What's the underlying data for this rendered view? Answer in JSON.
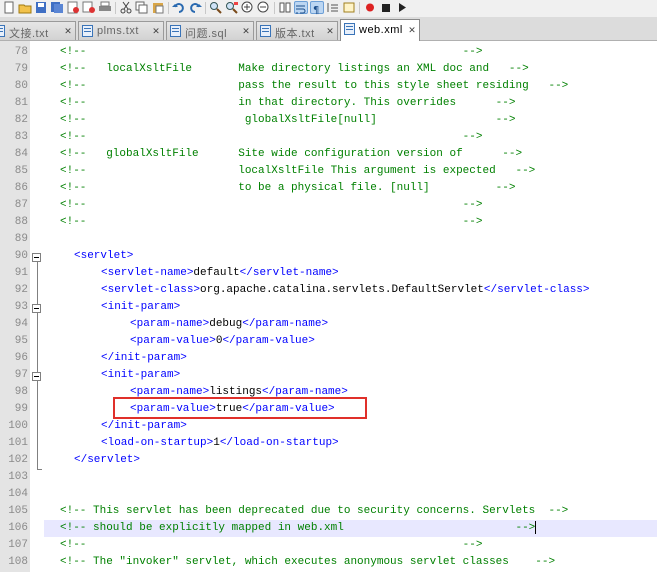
{
  "toolbar": {
    "buttons": [
      "new-file-icon",
      "open-file-icon",
      "save-icon",
      "save-all-icon",
      "close-icon",
      "close-all-icon",
      "print-icon",
      "cut-icon",
      "copy-icon",
      "paste-icon",
      "undo-icon",
      "redo-icon",
      "find-icon",
      "replace-icon",
      "zoom-in-icon",
      "zoom-out-icon",
      "sync-scroll-icon",
      "word-wrap-icon",
      "show-all-chars-icon",
      "indent-guide-icon",
      "user-lang-icon",
      "record-macro-icon",
      "stop-record-icon",
      "play-macro-icon"
    ],
    "active": [
      "word-wrap-icon",
      "show-all-chars-icon"
    ]
  },
  "tabs": [
    {
      "label": "文接.txt",
      "active": false
    },
    {
      "label": "plms.txt",
      "active": false
    },
    {
      "label": "问题.sql",
      "active": false
    },
    {
      "label": "版本.txt",
      "active": false
    },
    {
      "label": "web.xml",
      "active": true
    }
  ],
  "lines": [
    {
      "n": "78",
      "text": "<!--                                                         -->"
    },
    {
      "n": "79",
      "text": "<!--   localXsltFile       Make directory listings an XML doc and   -->"
    },
    {
      "n": "80",
      "text": "<!--                       pass the result to this style sheet residing   -->"
    },
    {
      "n": "81",
      "text": "<!--                       in that directory. This overrides      -->"
    },
    {
      "n": "82",
      "text": "<!--                        globalXsltFile[null]                  -->"
    },
    {
      "n": "83",
      "text": "<!--                                                         -->"
    },
    {
      "n": "84",
      "text": "<!--   globalXsltFile      Site wide configuration version of      -->"
    },
    {
      "n": "85",
      "text": "<!--                       localXsltFile This argument is expected   -->"
    },
    {
      "n": "86",
      "text": "<!--                       to be a physical file. [null]          -->"
    },
    {
      "n": "87",
      "text": "<!--                                                         -->"
    },
    {
      "n": "88",
      "text": "<!--                                                         -->"
    },
    {
      "n": "89",
      "text": ""
    },
    {
      "n": "90",
      "text": "<servlet>"
    },
    {
      "n": "91",
      "text": "<servlet-name>default</servlet-name>"
    },
    {
      "n": "92",
      "text": "<servlet-class>org.apache.catalina.servlets.DefaultServlet</servlet-class>"
    },
    {
      "n": "93",
      "text": "<init-param>"
    },
    {
      "n": "94",
      "text": "<param-name>debug</param-name>"
    },
    {
      "n": "95",
      "text": "<param-value>0</param-value>"
    },
    {
      "n": "96",
      "text": "</init-param>"
    },
    {
      "n": "97",
      "text": "<init-param>"
    },
    {
      "n": "98",
      "text": "<param-name>listings</param-name>"
    },
    {
      "n": "99",
      "text": "<param-value>true</param-value>"
    },
    {
      "n": "100",
      "text": "</init-param>"
    },
    {
      "n": "101",
      "text": "<load-on-startup>1</load-on-startup>"
    },
    {
      "n": "102",
      "text": "</servlet>"
    },
    {
      "n": "103",
      "text": ""
    },
    {
      "n": "104",
      "text": ""
    },
    {
      "n": "105",
      "text": "<!-- This servlet has been deprecated due to security concerns. Servlets  -->"
    },
    {
      "n": "106",
      "text": "<!-- should be explicitly mapped in web.xml                          -->"
    },
    {
      "n": "107",
      "text": "<!--                                                         -->"
    },
    {
      "n": "108",
      "text": "<!-- The \"invoker\" servlet, which executes anonymous servlet classes    -->"
    }
  ],
  "highlighted_line": "106",
  "colors": {
    "comment": "#008000",
    "tag": "#0000ff",
    "text": "#000000",
    "annotation_box": "#e0302a",
    "current_line": "#e8e8ff"
  }
}
